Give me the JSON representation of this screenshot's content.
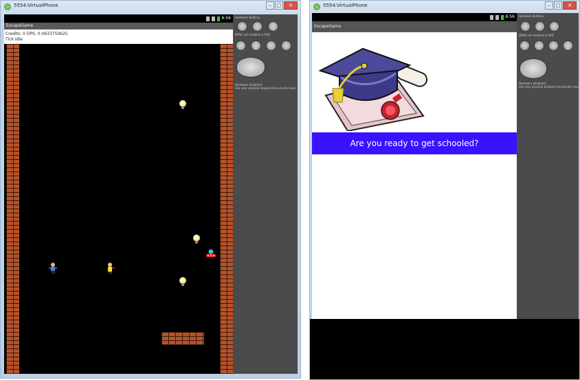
{
  "left_window": {
    "title": "5554:VirtualPhone",
    "statusbar": {
      "time": "6:56"
    },
    "actionbar_title": "EscapeGame",
    "info": {
      "line1": "Credits: 0  DPS: 0.0633750625",
      "line2": "Tick Idle"
    },
    "controls_labels": {
      "hardware_buttons": "Hardware Buttons",
      "dpad_label": "DPAD not enabled in AVD",
      "keyboard_label": "Hardware keyboard",
      "keyboard_sub": "Use your physical keyboard to provide input"
    }
  },
  "right_window": {
    "title": "5554:VirtualPhone",
    "statusbar": {
      "time": "6:56"
    },
    "actionbar_title": "EscapeGame",
    "banner_text": "Are you ready to get schooled?",
    "controls_labels": {
      "hardware_buttons": "Hardware Buttons",
      "dpad_label": "DPAD not enabled in AVD",
      "keyboard_label": "Hardware keyboard",
      "keyboard_sub": "Use your physical keyboard to provide input"
    }
  },
  "icons": {
    "window_close": "close-icon",
    "window_min": "minimize-icon",
    "window_max": "maximize-icon"
  },
  "colors": {
    "banner": "#3b12ff",
    "brick": "#b5532b",
    "game_bg": "#000000",
    "controls_bg": "#4b4b4b"
  }
}
